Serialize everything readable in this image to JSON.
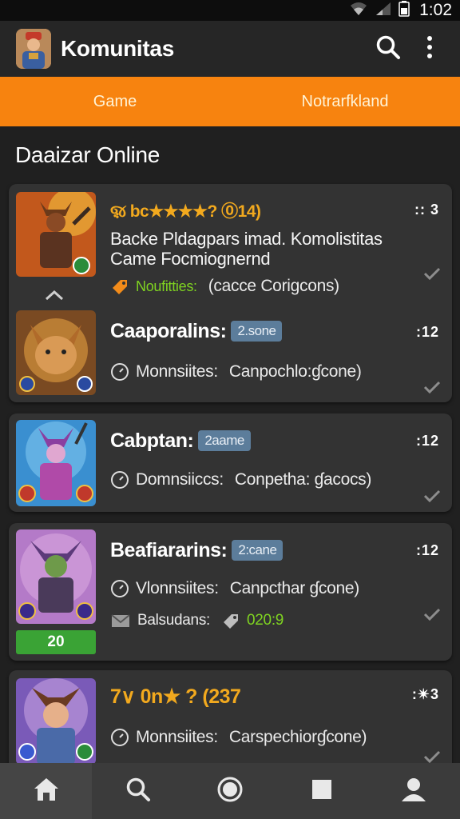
{
  "status": {
    "time": "1:02"
  },
  "appbar": {
    "title": "Komunitas"
  },
  "tabs": [
    {
      "label": "Game"
    },
    {
      "label": "Notrarfkland"
    }
  ],
  "section": {
    "title": "Daaizar Online"
  },
  "cards": [
    {
      "rows": [
        {
          "rating_text": "ૹ bc★★★★? ⓪14)",
          "more": ":: 3",
          "desc_line1": "Backe Pldagpars imad. Komolistitas",
          "desc_line2": "Came Focmiognernd",
          "meta_label": "Noufitties:",
          "meta_value": "(cacce Corigcons)"
        },
        {
          "title": "Caaporalins:",
          "badge": "2.sone",
          "more": ":12",
          "meta_label": "Monnsiites:",
          "meta_value": "Canpochlo:ɠcone)"
        }
      ]
    },
    {
      "rows": [
        {
          "title": "Cabptan:",
          "badge": "2aame",
          "more": ":12",
          "meta_label": "Domnsiiccs:",
          "meta_value": "Conpetha: ɠacocs)"
        }
      ]
    },
    {
      "rows": [
        {
          "title": "Beafiararins:",
          "badge": "2:cane",
          "more": ":12",
          "meta_label": "Vlonnsiites:",
          "meta_value": "Canpcthar ɠcone)",
          "meta2_label": "Balsudans:",
          "meta2_value": "020:9",
          "score": "20"
        }
      ]
    },
    {
      "rows": [
        {
          "rating_text": "7∨ 0n★ ? (237",
          "more": ":✴3",
          "meta_label": "Monnsiites:",
          "meta_value": "Carspechiorɠcone)"
        }
      ]
    }
  ],
  "bottom_nav": [
    {
      "icon": "home-icon"
    },
    {
      "icon": "search-icon"
    },
    {
      "icon": "circle-icon"
    },
    {
      "icon": "square-icon"
    },
    {
      "icon": "profile-icon"
    }
  ],
  "colors": {
    "accent": "#f7830f",
    "rating": "#f2a91e",
    "badge": "#5c7d9b",
    "success": "#3aa335"
  }
}
